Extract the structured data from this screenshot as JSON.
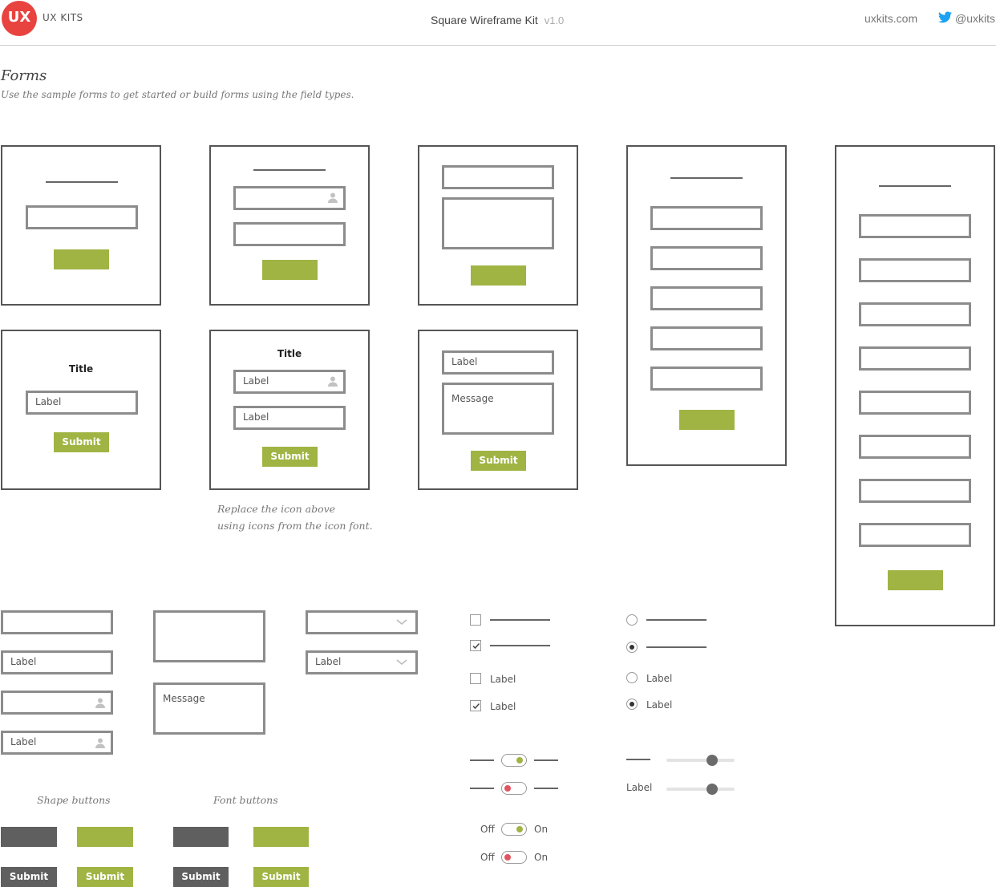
{
  "header": {
    "logo_mark": "UX",
    "brand": "UX KITS",
    "kit_title": "Square Wireframe Kit",
    "version": "v1.0",
    "site": "uxkits.com",
    "twitter": "@uxkits"
  },
  "section": {
    "title": "Forms",
    "subtitle": "Use the sample forms to get started or build forms using the field types."
  },
  "forms": {
    "title": "Title",
    "label": "Label",
    "message": "Message",
    "submit": "Submit"
  },
  "note": {
    "line1": "Replace the icon above",
    "line2": "using icons from the icon font."
  },
  "fields": {
    "label": "Label",
    "message": "Message"
  },
  "buttons": {
    "shape_caption": "Shape buttons",
    "font_caption": "Font buttons",
    "submit": "Submit"
  },
  "controls": {
    "label": "Label",
    "off": "Off",
    "on": "On"
  },
  "colors": {
    "accent": "#a0b444",
    "dark_button": "#5f5f5f",
    "logo_red": "#e8433f",
    "twitter_blue": "#1da1f2",
    "toggle_on": "#a0b444",
    "toggle_off": "#e05560"
  },
  "icons": [
    "user-icon",
    "chevron-down-icon",
    "twitter-bird-icon",
    "check-icon"
  ]
}
